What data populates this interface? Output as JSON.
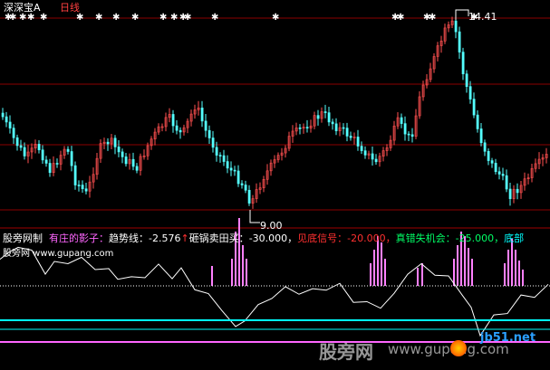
{
  "header": {
    "stock_name": "深深宝A",
    "period": "日线"
  },
  "price_panel": {
    "high_label": "14.41",
    "low_label": "9.00",
    "signal_marker_glyph": "✱"
  },
  "indicator_bar": {
    "formula_name": "股旁网制",
    "items": [
      {
        "label": "有庄的影子：",
        "color": "#ff66ff"
      },
      {
        "label": "趋势线：",
        "color": "#ffffff"
      },
      {
        "label": "-2.576",
        "color": "#ffffff"
      },
      {
        "label": "↑",
        "color": "#ff3030"
      },
      {
        "label": "砸锅卖田买：",
        "color": "#ffffff"
      },
      {
        "label": "-30.000，",
        "color": "#ffffff"
      },
      {
        "label": "见底信号：",
        "color": "#ff3030"
      },
      {
        "label": "-20.000，",
        "color": "#ff3030"
      },
      {
        "label": "真错失机会：",
        "color": "#00ff66"
      },
      {
        "label": "-25.000，",
        "color": "#00ff66"
      },
      {
        "label": "底部",
        "color": "#00ffff"
      }
    ]
  },
  "watermarks": {
    "top_left": "股旁网 www.gupang.com",
    "bottom_brand": "股旁网",
    "bottom_url": "www.gupang.com",
    "corner_brand": "jb51.net"
  },
  "colors": {
    "up_candle": "#ff5050",
    "down_candle": "#54ffff",
    "grid_red": "#8b0000",
    "indicator_line": "#ffffff",
    "bar_magenta": "#ff80ff",
    "baseline_cyan": "#00ffff",
    "baseline_magenta": "#ff66ff"
  }
}
